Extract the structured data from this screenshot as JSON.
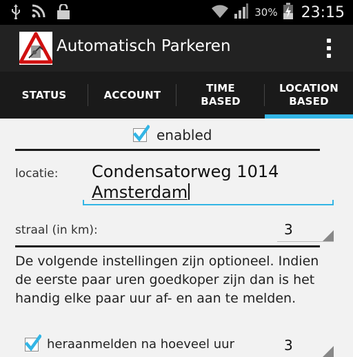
{
  "status_bar": {
    "battery_percent": "30%",
    "time": "23:15"
  },
  "app": {
    "title": "Automatisch Parkeren"
  },
  "tabs": [
    {
      "label": "STATUS",
      "active": false
    },
    {
      "label": "ACCOUNT",
      "active": false
    },
    {
      "label": "TIME\nBASED",
      "active": false
    },
    {
      "label": "LOCATION\nBASED",
      "active": true
    }
  ],
  "form": {
    "enabled_label": "enabled",
    "enabled_checked": true,
    "location_label": "locatie:",
    "location_line1": "Condensatorweg 1014",
    "location_line2": "Amsterdam",
    "radius_label": "straal (in km):",
    "radius_value": "3",
    "optional_text": "De volgende instellingen zijn optioneel. Indien de eerste paar uren goedkoper zijn dan is het handig elke paar uur af- en aan te melden.",
    "reregister_label": "heraanmelden na hoeveel uur",
    "reregister_checked": true,
    "reregister_value": "3"
  },
  "colors": {
    "accent": "#33b5e5",
    "actionbar": "#222222",
    "tabbar": "#1a1a1a",
    "background": "#f2f2f2"
  }
}
